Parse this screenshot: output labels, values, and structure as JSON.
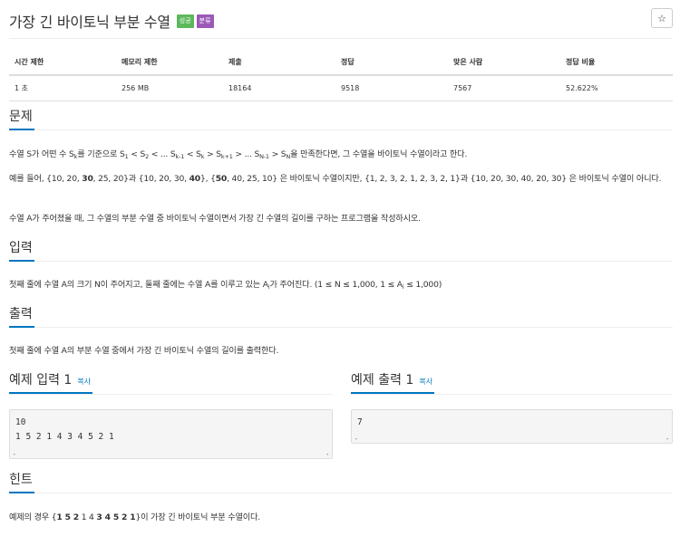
{
  "title": "가장 긴 바이토닉 부분 수열",
  "labels": {
    "success": "성공",
    "category": "분류"
  },
  "star_glyph": "☆",
  "info": {
    "headers": [
      "시간 제한",
      "메모리 제한",
      "제출",
      "정답",
      "맞은 사람",
      "정답 비율"
    ],
    "values": [
      "1 초",
      "256 MB",
      "18164",
      "9518",
      "7567",
      "52.622%"
    ]
  },
  "sections": {
    "problem": "문제",
    "input": "입력",
    "output": "출력",
    "hint": "힌트",
    "sample_input": "예제 입력 1",
    "sample_output": "예제 출력 1",
    "copy": "복사"
  },
  "problem": {
    "p1": {
      "a": "수열 S가 어떤 수 S",
      "k": "k",
      "b": "를 기준으로 S",
      "s1": "1",
      "c": " < S",
      "s2": "2",
      "d": " < ... S",
      "s3": "k-1",
      "e": " < S",
      "s4": "k",
      "f": " > S",
      "s5": "k+1",
      "g": " > ... S",
      "s6": "N-1",
      "h": " > S",
      "s7": "N",
      "i": "을 만족한다면, 그 수열을 바이토닉 수열이라고 한다."
    },
    "p2": {
      "a": "예를 들어, {10, 20, ",
      "b1": "30",
      "c": ", 25, 20}과 {10, 20, 30, ",
      "b2": "40",
      "d": "}, {",
      "b3": "50",
      "e": ", 40, 25, 10} 은 바이토닉 수열이지만,  {1, 2, 3, 2, 1, 2, 3, 2, 1}과 {10, 20, 30, 40, 20, 30} 은 바이토닉 수열이 아니다."
    },
    "p3": "수열 A가 주어졌을 때, 그 수열의 부분 수열 중 바이토닉 수열이면서 가장 긴 수열의 길이를 구하는 프로그램을 작성하시오."
  },
  "input_text": {
    "a": "첫째 줄에 수열 A의 크기 N이 주어지고, 둘째 줄에는 수열 A를 이루고 있는 A",
    "sub": "i",
    "b": "가 주어진다. (1 ≤ N ≤ 1,000, 1 ≤ A",
    "sub2": "i",
    "c": " ≤ 1,000)"
  },
  "output_text": "첫째 줄에 수열 A의 부분 수열 중에서 가장 긴 바이토닉 수열의 길이를 출력한다.",
  "sample_input_code": "10\n1 5 2 1 4 3 4 5 2 1",
  "sample_output_code": "7",
  "hint_text": {
    "a": "예제의 경우 {",
    "b1": "1",
    "s1": " ",
    "b2": "5",
    "s2": " ",
    "b3": "2",
    "c": " 1 4 ",
    "b4": "3",
    "s3": " ",
    "b5": "4",
    "s4": " ",
    "b6": "5",
    "s5": " ",
    "b7": "2",
    "s6": " ",
    "b8": "1",
    "d": "}이 가장 긴 바이토닉 부분 수열이다."
  },
  "scroll": {
    "left": "◂",
    "right": "▸"
  }
}
